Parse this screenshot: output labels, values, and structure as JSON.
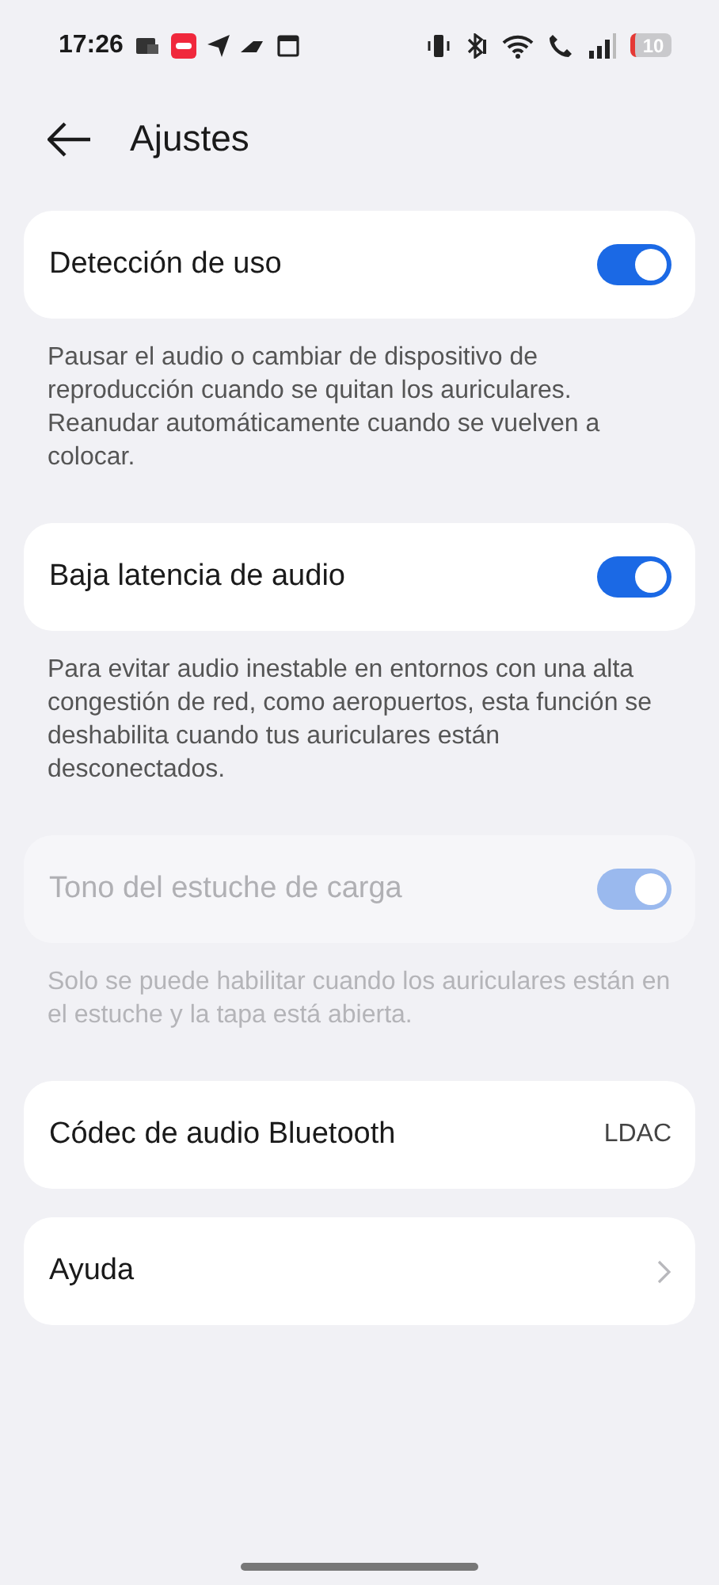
{
  "status_bar": {
    "time": "17:26",
    "battery": "10"
  },
  "header": {
    "title": "Ajustes"
  },
  "sections": [
    {
      "kind": "toggle",
      "label": "Detección de uso",
      "on": true,
      "disabled": false,
      "description": "Pausar el audio o cambiar de dispositivo de reproducción cuando se quitan los auriculares. Reanudar automáticamente cuando se vuelven a colocar."
    },
    {
      "kind": "toggle",
      "label": "Baja latencia de audio",
      "on": true,
      "disabled": false,
      "description": "Para evitar audio inestable en entornos con una alta congestión de red, como aeropuertos, esta función se deshabilita cuando tus auriculares están desconectados."
    },
    {
      "kind": "toggle",
      "label": "Tono del estuche de carga",
      "on": true,
      "disabled": true,
      "description": "Solo se puede habilitar cuando los auriculares están en el estuche y la tapa está abierta."
    },
    {
      "kind": "value",
      "label": "Códec de audio Bluetooth",
      "value": "LDAC"
    },
    {
      "kind": "link",
      "label": "Ayuda"
    }
  ]
}
